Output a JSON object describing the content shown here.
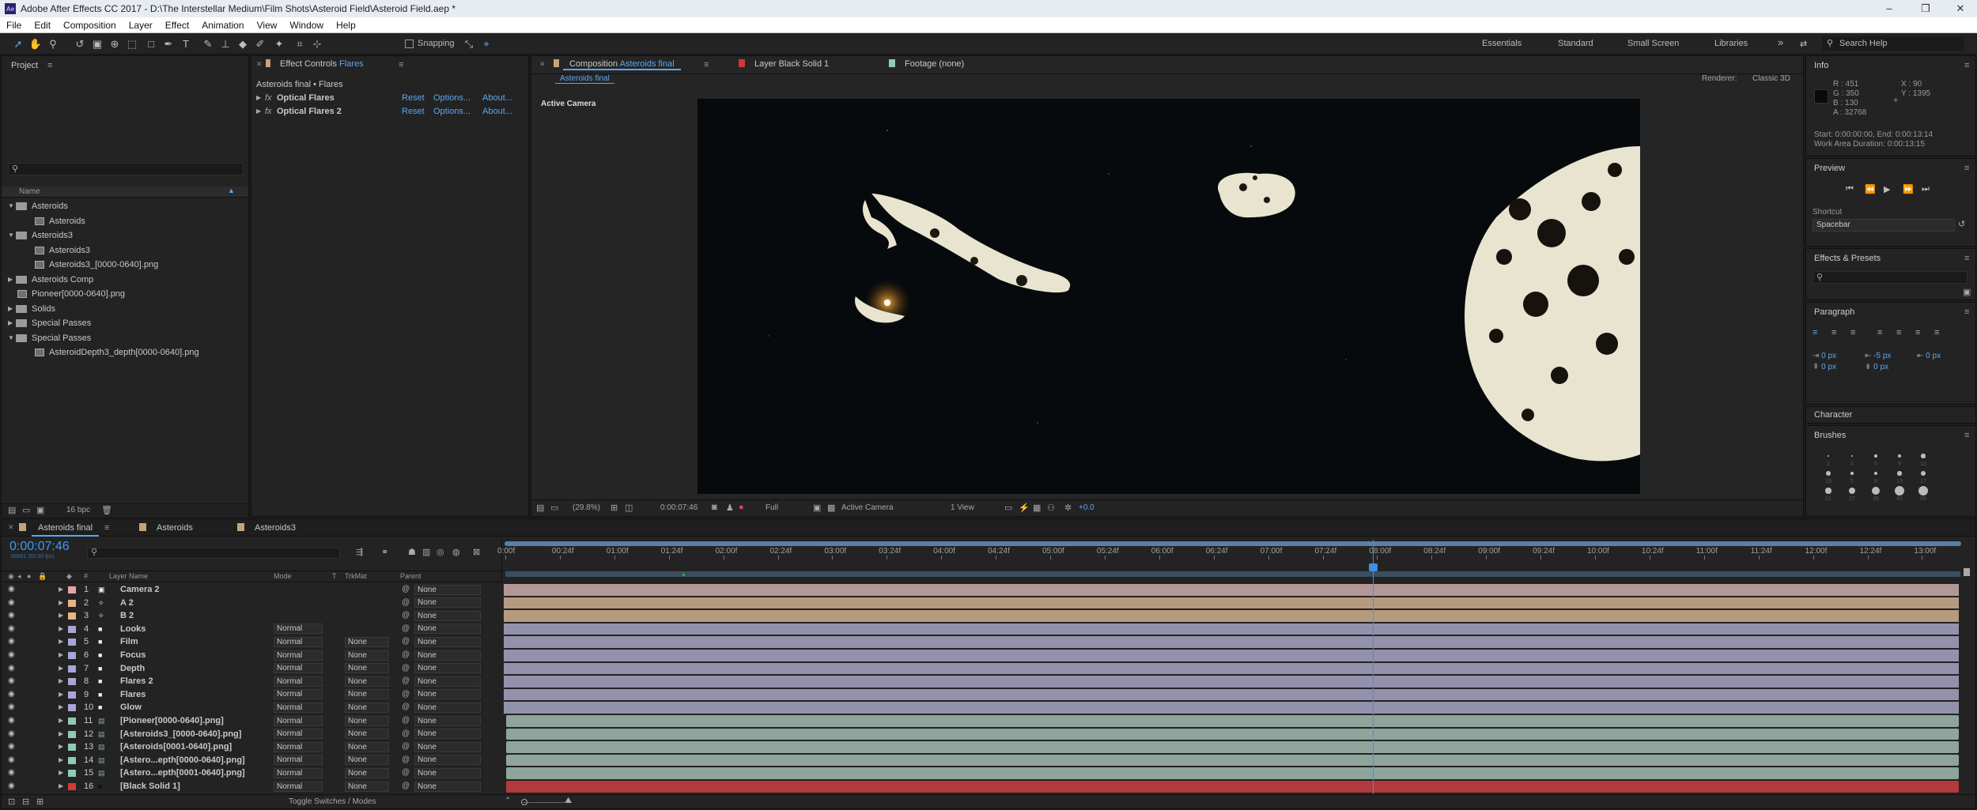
{
  "app": {
    "title": "Adobe After Effects CC 2017 - D:\\The Interstellar Medium\\Film Shots\\Asteroid Field\\Asteroid Field.aep *",
    "logo_text": "Ae"
  },
  "window_controls": {
    "minimize": "–",
    "maximize": "❐",
    "close": "✕"
  },
  "menu": [
    "File",
    "Edit",
    "Composition",
    "Layer",
    "Effect",
    "Animation",
    "View",
    "Window",
    "Help"
  ],
  "toolbar": {
    "snapping": "Snapping",
    "workspaces": [
      "Essentials",
      "Standard",
      "Small Screen",
      "Libraries"
    ],
    "more": "»",
    "search_help": "Search Help"
  },
  "project": {
    "title": "Project",
    "col_name": "Name",
    "bpc": "16 bpc",
    "items": [
      {
        "label": "Asteroids",
        "type": "folder",
        "indent": 0,
        "open": true
      },
      {
        "label": "Asteroids",
        "type": "comp",
        "indent": 1
      },
      {
        "label": "Asteroids3",
        "type": "folder",
        "indent": 0,
        "open": true
      },
      {
        "label": "Asteroids3",
        "type": "comp",
        "indent": 1
      },
      {
        "label": "Asteroids3_[0000-0640].png",
        "type": "comp",
        "indent": 1
      },
      {
        "label": "Asteroids Comp",
        "type": "folder",
        "indent": 0,
        "open": false
      },
      {
        "label": "Pioneer[0000-0640].png",
        "type": "comp",
        "indent": 0
      },
      {
        "label": "Solids",
        "type": "folder",
        "indent": 0,
        "open": false
      },
      {
        "label": "Special Passes",
        "type": "folder",
        "indent": 0,
        "open": false
      },
      {
        "label": "Special Passes",
        "type": "folder",
        "indent": 0,
        "open": true
      },
      {
        "label": "AsteroidDepth3_depth[0000-0640].png",
        "type": "comp",
        "indent": 1
      }
    ]
  },
  "effect_controls": {
    "tab": "Effect Controls",
    "tab_target": "Flares",
    "subtitle": "Asteroids final • Flares",
    "effects": [
      {
        "name": "Optical Flares",
        "reset": "Reset",
        "options": "Options...",
        "about": "About..."
      },
      {
        "name": "Optical Flares 2",
        "reset": "Reset",
        "options": "Options...",
        "about": "About..."
      }
    ]
  },
  "viewer": {
    "tab_comp": "Composition",
    "tab_comp_name": "Asteroids final",
    "tab_layer": "Layer Black Solid 1",
    "tab_footage": "Footage (none)",
    "breadcrumb": "Asteroids final",
    "renderer_label": "Renderer:",
    "renderer": "Classic 3D",
    "active_camera": "Active Camera",
    "bottom": {
      "zoom": "(29.8%)",
      "timecode": "0:00:07:46",
      "resolution": "Full",
      "camera": "Active Camera",
      "views": "1 View",
      "exposure": "+0.0"
    }
  },
  "info": {
    "title": "Info",
    "r": "R : 451",
    "g": "G : 350",
    "b": "B : 130",
    "a": "A : 32768",
    "x": "X : 90",
    "y": "Y : 1395",
    "start": "Start: 0:00:00:00, End: 0:00:13:14",
    "duration": "Work Area Duration: 0:00:13:15"
  },
  "preview": {
    "title": "Preview",
    "shortcut_label": "Shortcut",
    "shortcut": "Spacebar"
  },
  "effects_presets": {
    "title": "Effects & Presets"
  },
  "paragraph": {
    "title": "Paragraph",
    "fields": [
      "0 px",
      "-5 px",
      "0 px",
      "0 px",
      "0 px"
    ]
  },
  "character": {
    "title": "Character"
  },
  "brushes": {
    "title": "Brushes",
    "sizes": [
      "1",
      "3",
      "5",
      "9",
      "13",
      "19",
      "5",
      "9",
      "13",
      "17",
      "21",
      "27",
      "35",
      "45",
      "65"
    ]
  },
  "timeline": {
    "tabs": [
      "Asteroids final",
      "Asteroids",
      "Asteroids3"
    ],
    "tab_colors": [
      "#c4a47a",
      "#c4a47a",
      "#c4a47a"
    ],
    "timecode": "0:00:07:46",
    "timecode_sub": "00661 (60.00 fps)",
    "col_hash": "#",
    "col_layer": "Layer Name",
    "col_mode": "Mode",
    "col_t": "T",
    "col_trkmat": "TrkMat",
    "col_parent": "Parent",
    "toggle": "Toggle Switches / Modes",
    "ruler": [
      "0:00f",
      "00:24f",
      "01:00f",
      "01:24f",
      "02:00f",
      "02:24f",
      "03:00f",
      "03:24f",
      "04:00f",
      "04:24f",
      "05:00f",
      "05:24f",
      "06:00f",
      "06:24f",
      "07:00f",
      "07:24f",
      "08:00f",
      "08:24f",
      "09:00f",
      "09:24f",
      "10:00f",
      "10:24f",
      "11:00f",
      "11:24f",
      "12:00f",
      "12:24f",
      "13:00f"
    ],
    "current_time_fraction": 0.597,
    "layers": [
      {
        "num": "1",
        "name": "Camera 2",
        "label": "#e3a4a8",
        "mode": "",
        "trkmat": "",
        "parent": "None",
        "bar": "#b49797",
        "icon": "camera"
      },
      {
        "num": "2",
        "name": "A 2",
        "label": "#e8b384",
        "mode": "",
        "trkmat": "",
        "parent": "None",
        "bar": "#b59a80",
        "icon": "light"
      },
      {
        "num": "3",
        "name": "B 2",
        "label": "#e8b384",
        "mode": "",
        "trkmat": "",
        "parent": "None",
        "bar": "#b59a80",
        "icon": "light"
      },
      {
        "num": "4",
        "name": "Looks",
        "label": "#a7a6d6",
        "mode": "Normal",
        "trkmat": "",
        "parent": "None",
        "bar": "#9391ab",
        "icon": "solid"
      },
      {
        "num": "5",
        "name": "Film",
        "label": "#a7a6d6",
        "mode": "Normal",
        "trkmat": "None",
        "parent": "None",
        "bar": "#9391ab",
        "icon": "solid"
      },
      {
        "num": "6",
        "name": "Focus",
        "label": "#a7a6d6",
        "mode": "Normal",
        "trkmat": "None",
        "parent": "None",
        "bar": "#9391ab",
        "icon": "solid"
      },
      {
        "num": "7",
        "name": "Depth",
        "label": "#a7a6d6",
        "mode": "Normal",
        "trkmat": "None",
        "parent": "None",
        "bar": "#9391ab",
        "icon": "solid"
      },
      {
        "num": "8",
        "name": "Flares 2",
        "label": "#a7a6d6",
        "mode": "Normal",
        "trkmat": "None",
        "parent": "None",
        "bar": "#9391ab",
        "icon": "solid"
      },
      {
        "num": "9",
        "name": "Flares",
        "label": "#a7a6d6",
        "mode": "Normal",
        "trkmat": "None",
        "parent": "None",
        "bar": "#9391ab",
        "icon": "solid"
      },
      {
        "num": "10",
        "name": "Glow",
        "label": "#a7a6d6",
        "mode": "Normal",
        "trkmat": "None",
        "parent": "None",
        "bar": "#9391ab",
        "icon": "solid"
      },
      {
        "num": "11",
        "name": "[Pioneer[0000-0640].png]",
        "label": "#8fc9b8",
        "mode": "Normal",
        "trkmat": "None",
        "parent": "None",
        "bar": "#8fa59c",
        "icon": "footage"
      },
      {
        "num": "12",
        "name": "[Asteroids3_[0000-0640].png]",
        "label": "#8fc9b8",
        "mode": "Normal",
        "trkmat": "None",
        "parent": "None",
        "bar": "#8fa59c",
        "icon": "footage"
      },
      {
        "num": "13",
        "name": "[Asteroids[0001-0640].png]",
        "label": "#8fc9b8",
        "mode": "Normal",
        "trkmat": "None",
        "parent": "None",
        "bar": "#8fa59c",
        "icon": "footage"
      },
      {
        "num": "14",
        "name": "[Astero...epth[0000-0640].png]",
        "label": "#8fc9b8",
        "mode": "Normal",
        "trkmat": "None",
        "parent": "None",
        "bar": "#8fa59c",
        "icon": "footage"
      },
      {
        "num": "15",
        "name": "[Astero...epth[0001-0640].png]",
        "label": "#8fc9b8",
        "mode": "Normal",
        "trkmat": "None",
        "parent": "None",
        "bar": "#8fa59c",
        "icon": "footage"
      },
      {
        "num": "16",
        "name": "[Black Solid 1]",
        "label": "#d23b3b",
        "mode": "Normal",
        "trkmat": "None",
        "parent": "None",
        "bar": "#b03a3c",
        "icon": "black"
      }
    ]
  },
  "colors": {
    "accent": "#5aa7f2",
    "timecode": "#3c9bf5",
    "playhead": "#3d8fe0"
  }
}
